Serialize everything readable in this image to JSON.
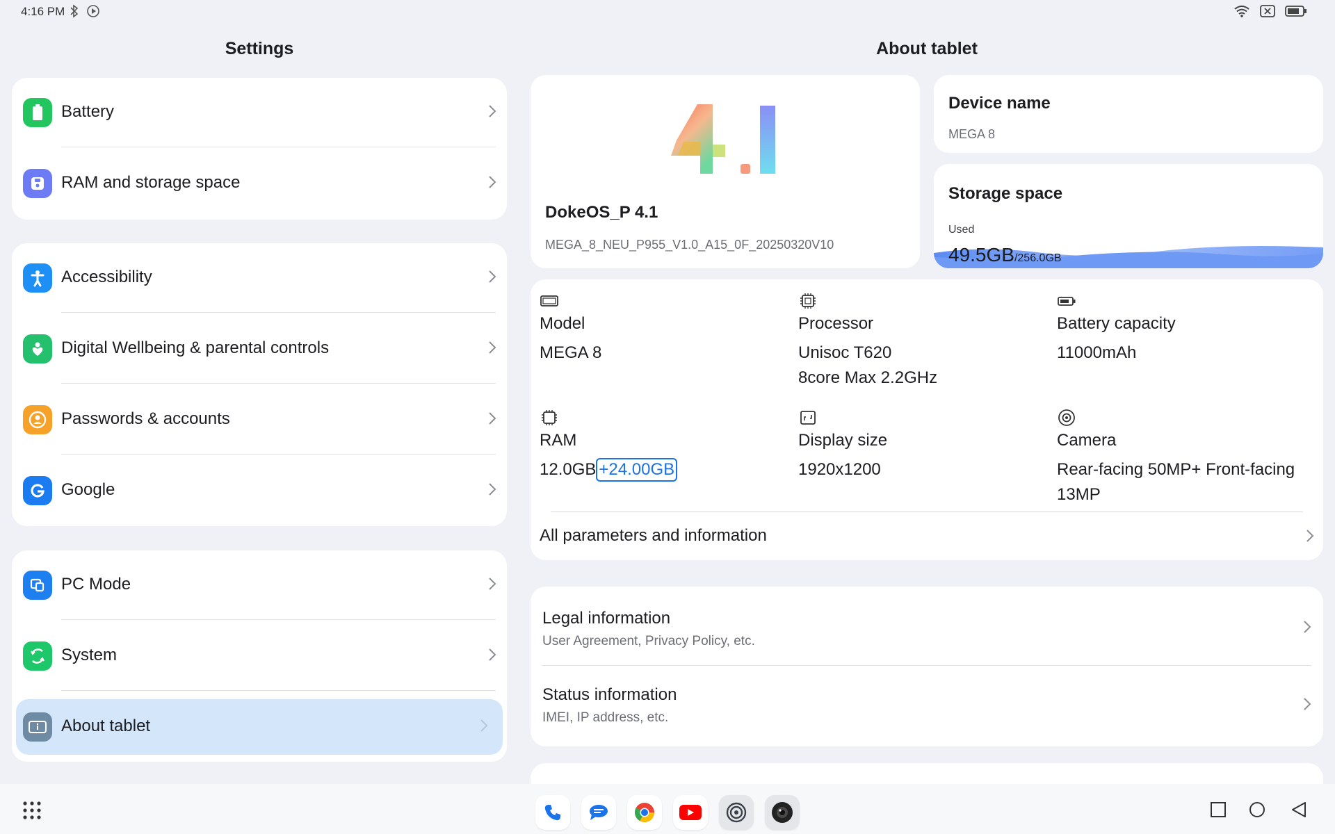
{
  "status_bar": {
    "time": "4:16 PM"
  },
  "left_pane": {
    "title": "Settings",
    "groups": [
      [
        {
          "label": "Battery",
          "icon": "battery-icon",
          "color": "#22c55e"
        },
        {
          "label": "RAM and storage space",
          "icon": "storage-icon",
          "color": "#6d7cf5"
        }
      ],
      [
        {
          "label": "Accessibility",
          "icon": "accessibility-icon",
          "color": "#1e8ff5"
        },
        {
          "label": "Digital Wellbeing & parental controls",
          "icon": "wellbeing-icon",
          "color": "#25c06d"
        },
        {
          "label": "Passwords & accounts",
          "icon": "account-icon",
          "color": "#f5a12a"
        },
        {
          "label": "Google",
          "icon": "google-icon",
          "color": "#1a7cf0"
        }
      ],
      [
        {
          "label": "PC Mode",
          "icon": "pc-mode-icon",
          "color": "#1e7ff0"
        },
        {
          "label": "System",
          "icon": "system-icon",
          "color": "#1ec76a"
        },
        {
          "label": "About tablet",
          "icon": "info-icon",
          "color": "#6f8aa3",
          "selected": true
        }
      ]
    ]
  },
  "right_pane": {
    "title": "About tablet",
    "os": {
      "logo_text": "4.1",
      "name": "DokeOS_P 4.1",
      "build": "MEGA_8_NEU_P955_V1.0_A15_0F_20250320V10"
    },
    "device_name": {
      "title": "Device name",
      "value": "MEGA 8"
    },
    "storage": {
      "title": "Storage space",
      "used_label": "Used",
      "used": "49.5GB",
      "total": "/256.0GB",
      "used_fraction": 0.193
    },
    "specs": {
      "model": {
        "label": "Model",
        "value": "MEGA 8"
      },
      "processor": {
        "label": "Processor",
        "value1": "Unisoc T620",
        "value2": "8core Max 2.2GHz"
      },
      "battery": {
        "label": "Battery capacity",
        "value": "11000mAh"
      },
      "ram": {
        "label": "RAM",
        "value": "12.0GB",
        "extra": "+24.00GB"
      },
      "display": {
        "label": "Display size",
        "value": "1920x1200"
      },
      "camera": {
        "label": "Camera",
        "value1": "Rear-facing 50MP+ Front-facing",
        "value2": "13MP"
      }
    },
    "all_params": "All parameters and information",
    "legal": {
      "title": "Legal information",
      "subtitle": "User Agreement, Privacy Policy, etc."
    },
    "status": {
      "title": "Status information",
      "subtitle": "IMEI, IP address, etc."
    }
  },
  "dock": [
    "phone-app",
    "messages-app",
    "chrome-app",
    "youtube-app",
    "settings-app",
    "camera-app"
  ]
}
